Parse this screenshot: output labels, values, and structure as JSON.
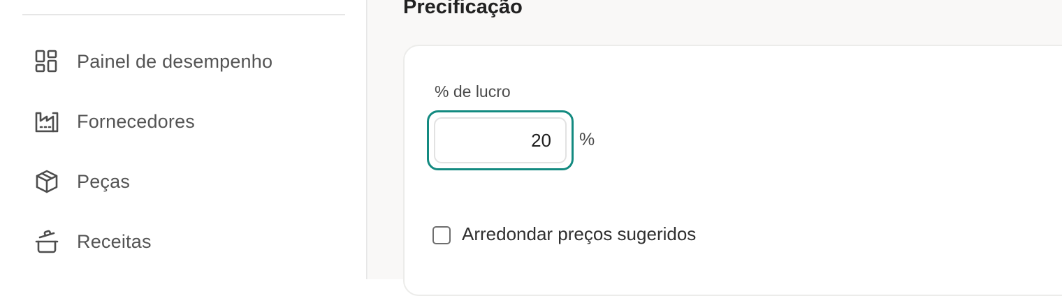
{
  "sidebar": {
    "items": [
      {
        "label": "Painel de desempenho",
        "icon": "dashboard-icon"
      },
      {
        "label": "Fornecedores",
        "icon": "factory-icon"
      },
      {
        "label": "Peças",
        "icon": "package-icon"
      },
      {
        "label": "Receitas",
        "icon": "cooking-pot-icon"
      }
    ]
  },
  "main": {
    "section_title": "Precificação",
    "profit_field": {
      "label": "% de lucro",
      "value": "20",
      "unit": "%"
    },
    "round_prices": {
      "label": "Arredondar preços sugeridos",
      "checked": false
    }
  },
  "colors": {
    "focus_ring": "#138a80",
    "main_background": "#f9f8f7",
    "sidebar_text": "#545454"
  }
}
